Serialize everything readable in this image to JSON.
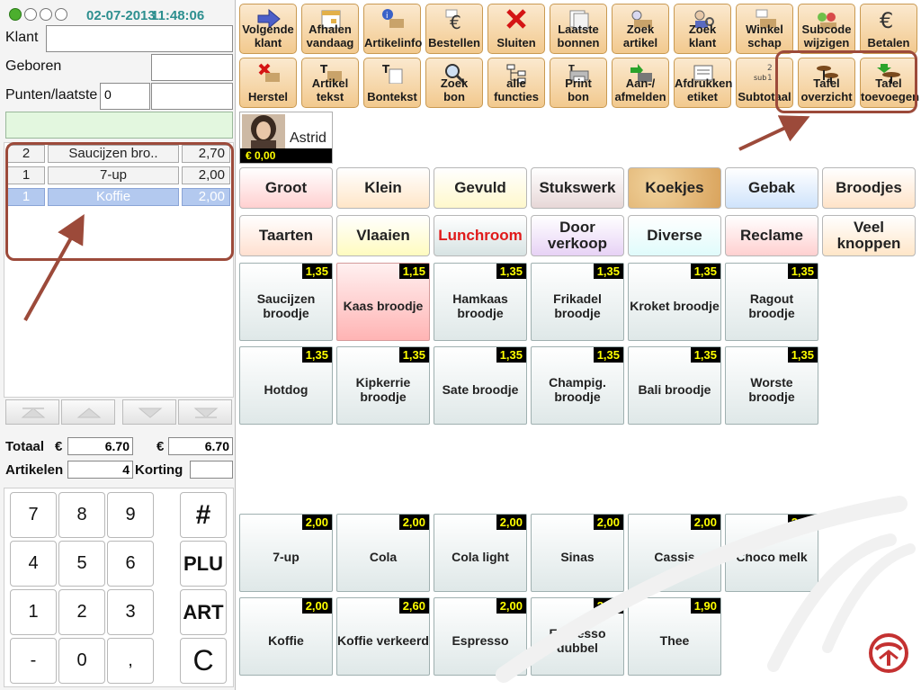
{
  "header": {
    "date": "02-07-2013",
    "time": "11:48:06"
  },
  "customer": {
    "klant_label": "Klant",
    "geboren_label": "Geboren",
    "punten_label": "Punten/laatste",
    "punten_value": "0"
  },
  "order": {
    "rows": [
      {
        "qty": "2",
        "name": "Saucijzen bro..",
        "price": "2,70"
      },
      {
        "qty": "1",
        "name": "7-up",
        "price": "2,00"
      },
      {
        "qty": "1",
        "name": "Koffie",
        "price": "2,00"
      }
    ]
  },
  "totals": {
    "totaal_label": "Totaal",
    "euro1": "€",
    "totaal_value": "6.70",
    "euro2": "€",
    "totaal_value2": "6.70",
    "artikelen_label": "Artikelen",
    "artikelen_value": "4",
    "korting_label": "Korting"
  },
  "keypad": [
    "7",
    "8",
    "9",
    "#",
    "4",
    "5",
    "6",
    "PLU",
    "1",
    "2",
    "3",
    "ART",
    "-",
    "0",
    ",",
    "C"
  ],
  "toolbar_row1": [
    {
      "icon": "arrow-right-icon",
      "label1": "Volgende",
      "label2": "klant"
    },
    {
      "icon": "calendar-icon",
      "label1": "Afhalen",
      "label2": "vandaag"
    },
    {
      "icon": "info-icon",
      "label1": "Artikelinfo",
      "label2": ""
    },
    {
      "icon": "euro-letter-icon",
      "label1": "Bestellen",
      "label2": ""
    },
    {
      "icon": "close-x-icon",
      "label1": "Sluiten",
      "label2": ""
    },
    {
      "icon": "receipts-icon",
      "label1": "Laatste",
      "label2": "bonnen"
    },
    {
      "icon": "search-product-icon",
      "label1": "Zoek",
      "label2": "artikel"
    },
    {
      "icon": "search-customer-icon",
      "label1": "Zoek",
      "label2": "klant"
    },
    {
      "icon": "shop-icon",
      "label1": "Winkel",
      "label2": "schap"
    },
    {
      "icon": "subcode-icon",
      "label1": "Subcode",
      "label2": "wijzigen"
    },
    {
      "icon": "euro-icon",
      "label1": "Betalen",
      "label2": ""
    }
  ],
  "toolbar_row2": [
    {
      "icon": "undo-icon",
      "label1": "Herstel",
      "label2": ""
    },
    {
      "icon": "text-icon",
      "label1": "Artikel",
      "label2": "tekst"
    },
    {
      "icon": "receipt-text-icon",
      "label1": "Bontekst",
      "label2": ""
    },
    {
      "icon": "magnifier-icon",
      "label1": "Zoek",
      "label2": "bon"
    },
    {
      "icon": "functions-icon",
      "label1": "alle",
      "label2": "functies"
    },
    {
      "icon": "printer-icon",
      "label1": "Print",
      "label2": "bon"
    },
    {
      "icon": "login-icon",
      "label1": "Aan-/",
      "label2": "afmelden"
    },
    {
      "icon": "label-print-icon",
      "label1": "Afdrukken",
      "label2": "etiket"
    },
    {
      "icon": "subtotal-icon",
      "label1": "Subtotaal",
      "label2": ""
    },
    {
      "icon": "tables-overview-icon",
      "label1": "Tafel",
      "label2": "overzicht"
    },
    {
      "icon": "table-add-icon",
      "label1": "Tafel",
      "label2": "toevoegen"
    }
  ],
  "profile": {
    "name": "Astrid",
    "balance": "€ 0,00"
  },
  "categories": [
    {
      "label": "Groot",
      "color": "#ffd0d0"
    },
    {
      "label": "Klein",
      "color": "#ffe6c8"
    },
    {
      "label": "Gevuld",
      "color": "#fff8cc"
    },
    {
      "label": "Stukswerk",
      "color": "#e7d7d7"
    },
    {
      "label": "Koekjes",
      "color": "#e9c38a"
    },
    {
      "label": "Gebak",
      "color": "#cfe3fb"
    },
    {
      "label": "Broodjes",
      "color": "#ffe3c8"
    },
    {
      "label": "Taarten",
      "color": "#ffe0d0"
    },
    {
      "label": "Vlaaien",
      "color": "#fffbbf"
    },
    {
      "label": "Lunchroom",
      "color": "#d7e3e3"
    },
    {
      "label": "Door verkoop",
      "color": "#e7d2f5"
    },
    {
      "label": "Diverse",
      "color": "#e0fbfb"
    },
    {
      "label": "Reclame",
      "color": "#ffd0d0"
    },
    {
      "label": "Veel knoppen",
      "color": "#ffe6c8"
    }
  ],
  "products": [
    {
      "name": "Saucijzen broodje",
      "price": "1,35",
      "pink": false
    },
    {
      "name": "Kaas broodje",
      "price": "1,15",
      "pink": true
    },
    {
      "name": "Hamkaas broodje",
      "price": "1,35",
      "pink": false
    },
    {
      "name": "Frikadel broodje",
      "price": "1,35",
      "pink": false
    },
    {
      "name": "Kroket broodje",
      "price": "1,35",
      "pink": false
    },
    {
      "name": "Ragout broodje",
      "price": "1,35",
      "pink": false
    },
    {
      "name": "Hotdog",
      "price": "1,35",
      "pink": false
    },
    {
      "name": "Kipkerrie broodje",
      "price": "1,35",
      "pink": false
    },
    {
      "name": "Sate broodje",
      "price": "1,35",
      "pink": false
    },
    {
      "name": "Champig. broodje",
      "price": "1,35",
      "pink": false
    },
    {
      "name": "Bali broodje",
      "price": "1,35",
      "pink": false
    },
    {
      "name": "Worste broodje",
      "price": "1,35",
      "pink": false
    },
    {
      "name": "7-up",
      "price": "2,00",
      "pink": false
    },
    {
      "name": "Cola",
      "price": "2,00",
      "pink": false
    },
    {
      "name": "Cola light",
      "price": "2,00",
      "pink": false
    },
    {
      "name": "Sinas",
      "price": "2,00",
      "pink": false
    },
    {
      "name": "Cassis",
      "price": "2,00",
      "pink": false
    },
    {
      "name": "Choco melk",
      "price": "2,20",
      "pink": false
    },
    {
      "name": "Koffie",
      "price": "2,00",
      "pink": false
    },
    {
      "name": "Koffie verkeerd",
      "price": "2,60",
      "pink": false
    },
    {
      "name": "Espresso",
      "price": "2,00",
      "pink": false
    },
    {
      "name": "Espresso dubbel",
      "price": "2,60",
      "pink": false
    },
    {
      "name": "Thee",
      "price": "1,90",
      "pink": false
    }
  ]
}
